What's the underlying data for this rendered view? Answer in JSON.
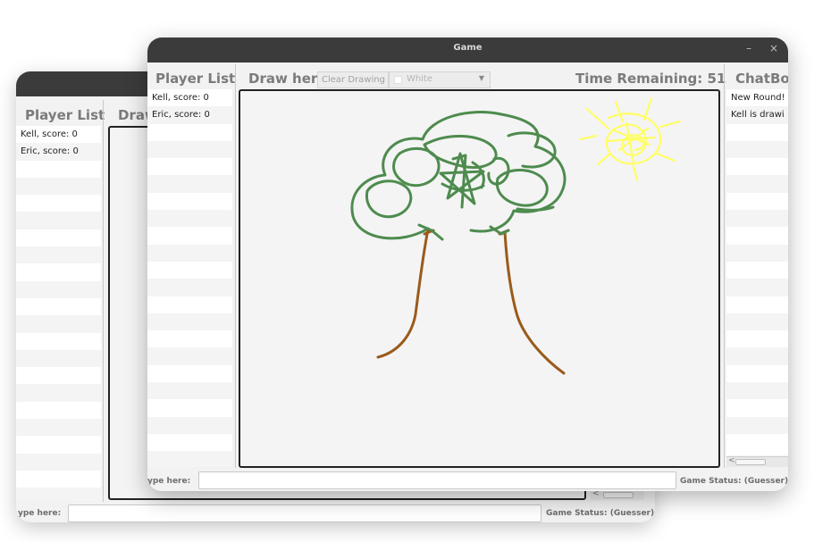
{
  "back_window": {
    "player_list_header": "Player List",
    "draw_header": "Draw",
    "players": [
      "Kell, score: 0",
      "Eric, score: 0"
    ],
    "type_here_label": "ype here:",
    "game_status_label": "Game Status: (Guesser)"
  },
  "front_window": {
    "title": "Game",
    "minimize_glyph": "–",
    "close_glyph": "×",
    "player_list_header": "Player List",
    "draw_header": "Draw here",
    "clear_button_label": "Clear Drawing",
    "color_select_value": "White",
    "time_remaining": "Time Remaining: 51",
    "chatbox_header": "ChatBo",
    "players": [
      "Kell, score: 0",
      "Eric, score: 0"
    ],
    "chat_messages": [
      "New Round!",
      "Kell is drawi"
    ],
    "type_here_label": "ype here:",
    "game_status_label": "Game Status: (Guesser)",
    "scroll_left_glyph": "<"
  },
  "drawing_colors": {
    "tree_crown": "#4e8b4e",
    "tree_trunk": "#9a5a1a",
    "sun": "#ffff66"
  },
  "icons": {
    "combo_arrow": "chevron-down-icon",
    "scroll_left": "chevron-left-icon"
  }
}
